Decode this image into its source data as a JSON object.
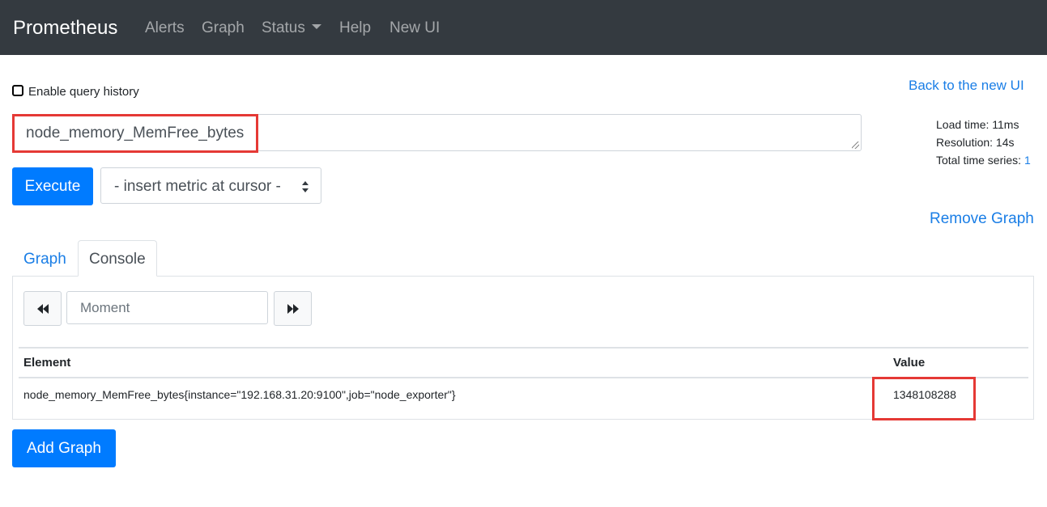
{
  "navbar": {
    "brand": "Prometheus",
    "items": [
      "Alerts",
      "Graph",
      "Status",
      "Help",
      "New UI"
    ]
  },
  "history_label": "Enable query history",
  "back_link": "Back to the new UI",
  "query": {
    "expression": "node_memory_MemFree_bytes"
  },
  "stats": {
    "load_time": "Load time: 11ms",
    "resolution": "Resolution: 14s",
    "total_series_label": "Total time series: ",
    "total_series_value": "1"
  },
  "execute_label": "Execute",
  "metric_select": "- insert metric at cursor -",
  "remove_graph": "Remove Graph",
  "tabs": {
    "graph": "Graph",
    "console": "Console"
  },
  "moment_placeholder": "Moment",
  "table": {
    "columns": [
      "Element",
      "Value"
    ],
    "rows": [
      {
        "element": "node_memory_MemFree_bytes{instance=\"192.168.31.20:9100\",job=\"node_exporter\"}",
        "value": "1348108288"
      }
    ]
  },
  "add_graph": "Add Graph",
  "colors": {
    "navbar": "#343a40",
    "primary": "#007bff",
    "link": "#1a7ee6",
    "highlight": "#e53935"
  }
}
